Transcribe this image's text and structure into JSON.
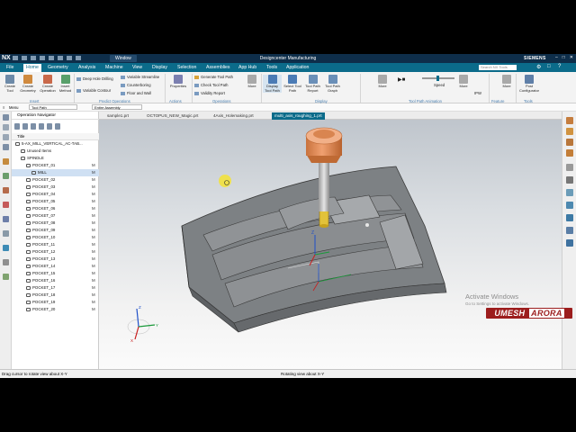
{
  "title_bar": {
    "app_logo": "NX",
    "window_menu": "Window",
    "title": "Designcenter Manufacturing",
    "brand": "SIEMENS"
  },
  "menu_tabs": [
    "File",
    "Home",
    "Geometry",
    "Analysis",
    "Machine",
    "View",
    "Display",
    "Selection",
    "Assemblies",
    "App Hub",
    "Tools",
    "Application"
  ],
  "search_placeholder": "Search NX Tools",
  "ribbon": {
    "insert": {
      "create_tool": "Create Tool",
      "create_geometry": "Create Geometry",
      "create_operation": "Create Operation",
      "insert_method": "Insert Method",
      "group": "Insert"
    },
    "predict": {
      "deep_hole": "Deep Hole Drilling",
      "variable_contour": "Variable Contour",
      "variable_streamline": "Variable Streamline",
      "counterboring": "Counterboring",
      "floor_and_wall": "Floor and Wall",
      "group": "Predict Operations"
    },
    "actions": {
      "properties": "Properties",
      "group": "Actions"
    },
    "operations": {
      "generate": "Generate Tool Path",
      "check": "Check Tool Path",
      "validity": "Validity Report",
      "group": "Operations"
    },
    "more1": "More",
    "display": {
      "display_tool_path": "Display Tool Path",
      "select_tool_path": "Select Tool Path",
      "tool_path_report": "Tool Path Report",
      "tool_path_graph": "Tool Path Graph",
      "group": "Display"
    },
    "animation": {
      "more": "More",
      "speed": "Speed",
      "group": "Tool Path Animation"
    },
    "more2": "More",
    "ipw": "IPW",
    "feature": {
      "more": "More",
      "group": "Feature"
    },
    "tools": {
      "post_configurator": "Post Configurator",
      "group": "Tools"
    }
  },
  "toolbar2": {
    "menu": "Menu",
    "filter": "Tool Path",
    "scope": "Entire Assembly"
  },
  "navigator": {
    "title": "Operation Navigator",
    "column_title": "Title",
    "items": [
      {
        "label": "5-AX_MILL_VERTICAL_AC-TAB...",
        "indent": 0,
        "status": ""
      },
      {
        "label": "Unused Items",
        "indent": 1,
        "status": ""
      },
      {
        "label": "SPINDLE",
        "indent": 1,
        "status": ""
      },
      {
        "label": "POCKET_01",
        "indent": 2,
        "status": "M"
      },
      {
        "label": "MILL",
        "indent": 3,
        "status": "M",
        "selected": true
      },
      {
        "label": "POCKET_02",
        "indent": 2,
        "status": "M"
      },
      {
        "label": "POCKET_03",
        "indent": 2,
        "status": "M"
      },
      {
        "label": "POCKET_04",
        "indent": 2,
        "status": "M"
      },
      {
        "label": "POCKET_05",
        "indent": 2,
        "status": "M"
      },
      {
        "label": "POCKET_06",
        "indent": 2,
        "status": "M"
      },
      {
        "label": "POCKET_07",
        "indent": 2,
        "status": "M"
      },
      {
        "label": "POCKET_08",
        "indent": 2,
        "status": "M"
      },
      {
        "label": "POCKET_09",
        "indent": 2,
        "status": "M"
      },
      {
        "label": "POCKET_10",
        "indent": 2,
        "status": "M"
      },
      {
        "label": "POCKET_11",
        "indent": 2,
        "status": "M"
      },
      {
        "label": "POCKET_12",
        "indent": 2,
        "status": "M"
      },
      {
        "label": "POCKET_13",
        "indent": 2,
        "status": "M"
      },
      {
        "label": "POCKET_14",
        "indent": 2,
        "status": "M"
      },
      {
        "label": "POCKET_15",
        "indent": 2,
        "status": "M"
      },
      {
        "label": "POCKET_16",
        "indent": 2,
        "status": "M"
      },
      {
        "label": "POCKET_17",
        "indent": 2,
        "status": "M"
      },
      {
        "label": "POCKET_18",
        "indent": 2,
        "status": "M"
      },
      {
        "label": "POCKET_19",
        "indent": 2,
        "status": "M"
      },
      {
        "label": "POCKET_20",
        "indent": 2,
        "status": "M"
      }
    ]
  },
  "doc_tabs": [
    "sample1.prt",
    "OCTOPUS_NEW_Magic.prt",
    "4Axis_Holemaking.prt",
    "multi_axis_roughing_1.prt"
  ],
  "active_tab": 3,
  "status": {
    "left": "Drag cursor to rotate view about X-Y",
    "center": "Rotating view about X-Y"
  },
  "watermark": {
    "line1": "Activate Windows",
    "line2": "Go to Settings to activate Windows."
  },
  "logo": {
    "part1": "UMESH",
    "part2": "ARORA"
  },
  "colors": {
    "title_bar": "#0e2e4a",
    "menu_bar": "#0b6b8a",
    "accent_orange": "#e3874d",
    "part_gray": "#808488",
    "logo_red": "#9c1d1d"
  }
}
